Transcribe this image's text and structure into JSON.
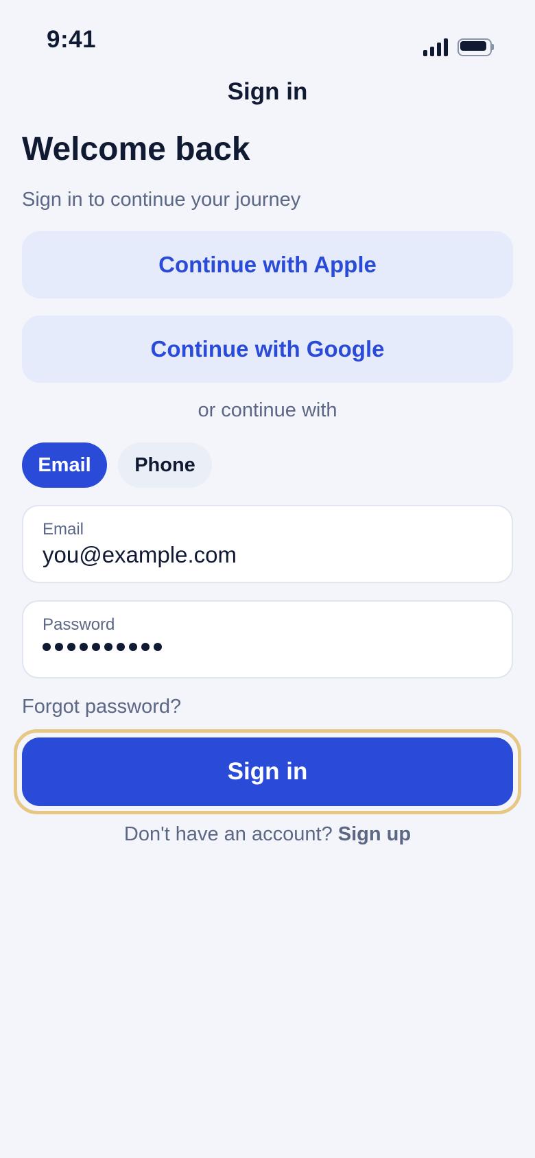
{
  "status_bar": {
    "time": "9:41",
    "signal_icon": "cellular-signal-icon",
    "battery_icon": "battery-icon"
  },
  "nav": {
    "title": "Sign in"
  },
  "header": {
    "title": "Welcome back",
    "subtitle": "Sign in to continue your journey"
  },
  "social": {
    "apple_label": "Continue with Apple",
    "google_label": "Continue with Google"
  },
  "divider": {
    "text": "or continue with"
  },
  "method_toggle": {
    "options": [
      "Email",
      "Phone"
    ],
    "selected": "Email"
  },
  "form": {
    "email": {
      "label": "Email",
      "value": "you@example.com"
    },
    "password": {
      "label": "Password",
      "masked_length": 10
    },
    "forgot_label": "Forgot password?",
    "submit_label": "Sign in"
  },
  "footer": {
    "prompt": "Don't have an account?",
    "signup_label": "Sign up"
  },
  "colors": {
    "background": "#f3f5fa",
    "primary": "#2a4ad8",
    "primary_tint": "#e6ebfb",
    "text_primary": "#111a33",
    "text_secondary": "#5b6785",
    "focus_ring": "#e6c783"
  }
}
